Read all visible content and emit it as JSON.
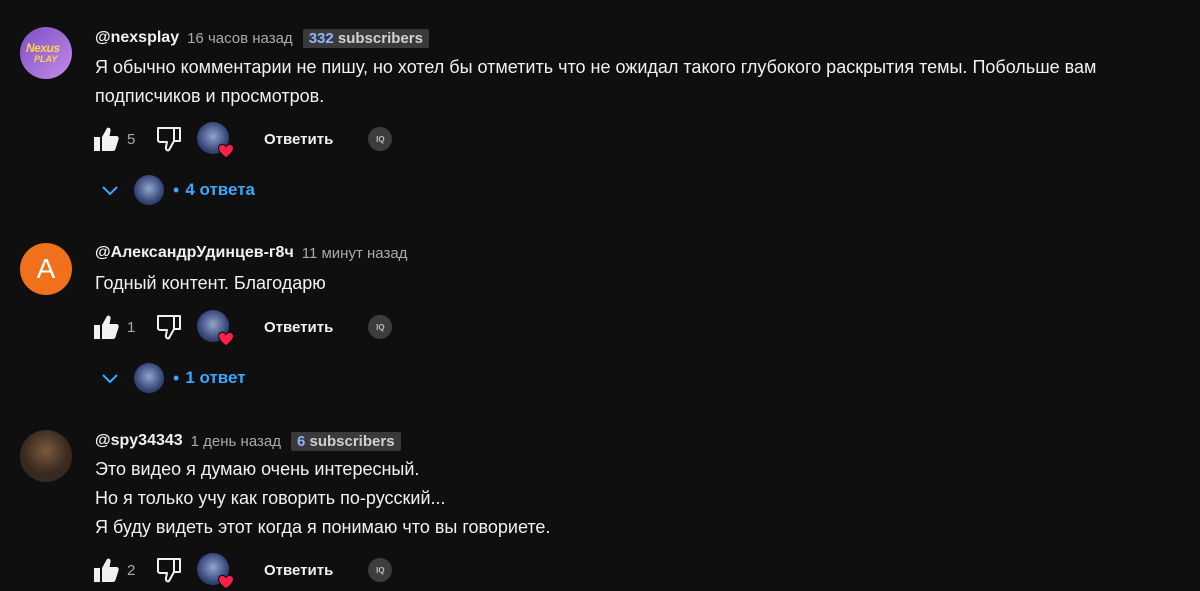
{
  "comments": [
    {
      "handle": "@nexsplay",
      "time": "16 часов назад",
      "subs_number": "332",
      "subs_label": " subscribers",
      "avatar_logo_line1": "Nexus",
      "avatar_logo_line2": "PLAY",
      "text": "Я обычно комментарии не пишу, но хотел бы отметить что не ожидал такого глубокого раскрытия темы. Побольше вам\nподписчиков и просмотров.",
      "likes": "5",
      "reply_label": "Ответить",
      "iq_label": "IQ",
      "replies_label": "4 ответа"
    },
    {
      "handle": "@АлександрУдинцев-г8ч",
      "time": "11 минут назад",
      "avatar_letter": "A",
      "text": "Годный контент. Благодарю",
      "likes": "1",
      "reply_label": "Ответить",
      "iq_label": "IQ",
      "replies_label": "1 ответ"
    },
    {
      "handle": "@spy34343",
      "time": "1 день назад",
      "subs_number": "6",
      "subs_label": " subscribers",
      "text": "Это видео я думаю очень интересный.\nНо я только учу как говорить по-русский...\nЯ буду видеть этот когда я понимаю что вы говориете.",
      "likes": "2",
      "reply_label": "Ответить",
      "iq_label": "IQ"
    }
  ],
  "replies_dot": "•",
  "colors": {
    "background": "#0f0f0f",
    "link_blue": "#3ea6ff",
    "heart_red": "#ff1f4b",
    "avatar_orange": "#f0701c"
  }
}
